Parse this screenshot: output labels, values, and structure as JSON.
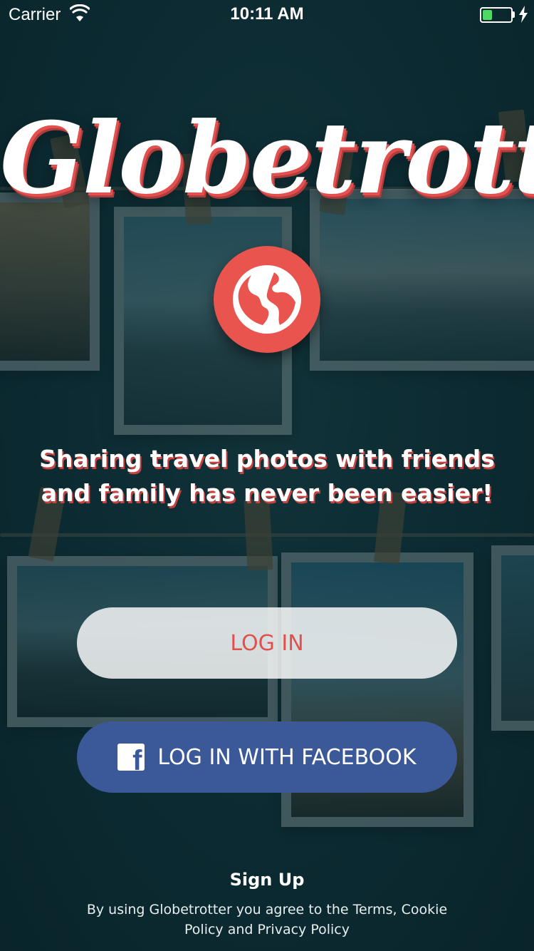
{
  "status_bar": {
    "carrier": "Carrier",
    "time": "10:11 AM",
    "battery_level": 0.35,
    "icons": [
      "wifi-icon",
      "battery-icon",
      "charging-icon"
    ]
  },
  "app": {
    "logo_text": "Globetrotter",
    "logo_icon": "globe-icon",
    "tagline": "Sharing travel photos with friends and family has never been easier!"
  },
  "buttons": {
    "login_label": "LOG IN",
    "facebook_label": "LOG IN WITH FACEBOOK",
    "facebook_icon": "facebook-icon"
  },
  "footer": {
    "signup_label": "Sign Up",
    "terms_text": "By using Globetrotter you agree to the Terms, Cookie Policy and Privacy Policy"
  },
  "colors": {
    "accent": "#e9544f",
    "facebook": "#3b5998",
    "background": "#12313a",
    "battery": "#4cd964"
  }
}
